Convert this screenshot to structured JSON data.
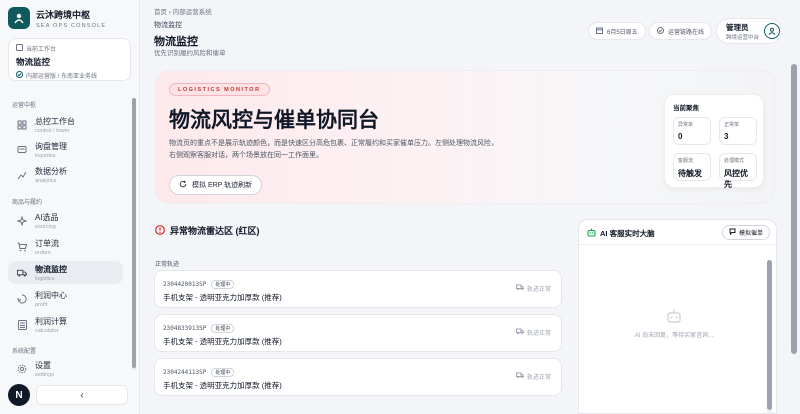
{
  "brand": {
    "title": "云沐跨境中枢",
    "subtitle": "SEA OPS CONSOLE"
  },
  "current": {
    "label": "当前工作台",
    "name": "物流监控",
    "path": "内部运营版 / 东南亚业务线"
  },
  "sidebar": {
    "sections": [
      "运营中枢",
      "商品与履约",
      "系统配置"
    ],
    "items": [
      {
        "label": "总控工作台",
        "sub": "control / tower",
        "icon": "grid-icon"
      },
      {
        "label": "询盘管理",
        "sub": "inquiries",
        "icon": "message-icon"
      },
      {
        "label": "数据分析",
        "sub": "analytics",
        "icon": "chart-icon"
      },
      {
        "label": "AI选品",
        "sub": "sourcing",
        "icon": "sparkle-icon"
      },
      {
        "label": "订单流",
        "sub": "orders",
        "icon": "cart-icon"
      },
      {
        "label": "物流监控",
        "sub": "logistics",
        "icon": "truck-icon"
      },
      {
        "label": "利润中心",
        "sub": "profit",
        "icon": "recycle-icon"
      },
      {
        "label": "利润计算",
        "sub": "calculator",
        "icon": "calculator-icon"
      },
      {
        "label": "设置",
        "sub": "settings",
        "icon": "gear-icon"
      }
    ],
    "avatar": "N",
    "collapse": "‹"
  },
  "header": {
    "crumb": "首页 › 内部运营系统",
    "sub": "物流监控",
    "title": "物流监控",
    "desc": "优先识别履约风险和催单",
    "date": "6月5日周五",
    "status": "运营链路在线",
    "user_name": "管理员",
    "user_role": "跨境运营中台"
  },
  "hero": {
    "tag": "LOGISTICS MONITOR",
    "title": "物流风控与催单协同台",
    "desc": "物流页的重点不是展示轨迹颜色，而是快速区分高危包裹、正常履约和买家催单压力。左侧处理物流风险，右侧观察客服对话，两个场景放在同一工作面里。",
    "button": "模拟 ERP 轨迹刷新",
    "focus": {
      "title": "当前聚焦",
      "boxes": [
        {
          "k": "异常单",
          "v": "0"
        },
        {
          "k": "正常单",
          "v": "3"
        },
        {
          "k": "客服流",
          "v": "待触发"
        },
        {
          "k": "处理模式",
          "v": "风控优先"
        }
      ]
    }
  },
  "radar": {
    "title": "异常物流雷达区 (红区)",
    "section": "正常轨迹",
    "rows": [
      {
        "no": "2304420013SP",
        "badge": "处理中",
        "product": "手机支架 - 透明亚克力加厚款 (推荐)",
        "status": "轨迹正常"
      },
      {
        "no": "2304833913SP",
        "badge": "处理中",
        "product": "手机支架 - 透明亚克力加厚款 (推荐)",
        "status": "轨迹正常"
      },
      {
        "no": "2304244113SP",
        "badge": "处理中",
        "product": "手机支架 - 透明亚克力加厚款 (推荐)",
        "status": "轨迹正常"
      }
    ]
  },
  "ai": {
    "title": "AI 客服实时大脑",
    "button": "模拟催单",
    "empty": "AI 尚未回复，等待买家咨询..."
  },
  "colors": {
    "brand": "#0f5a5c",
    "danger": "#dc2626",
    "accent_pink": "#fde2e6"
  }
}
